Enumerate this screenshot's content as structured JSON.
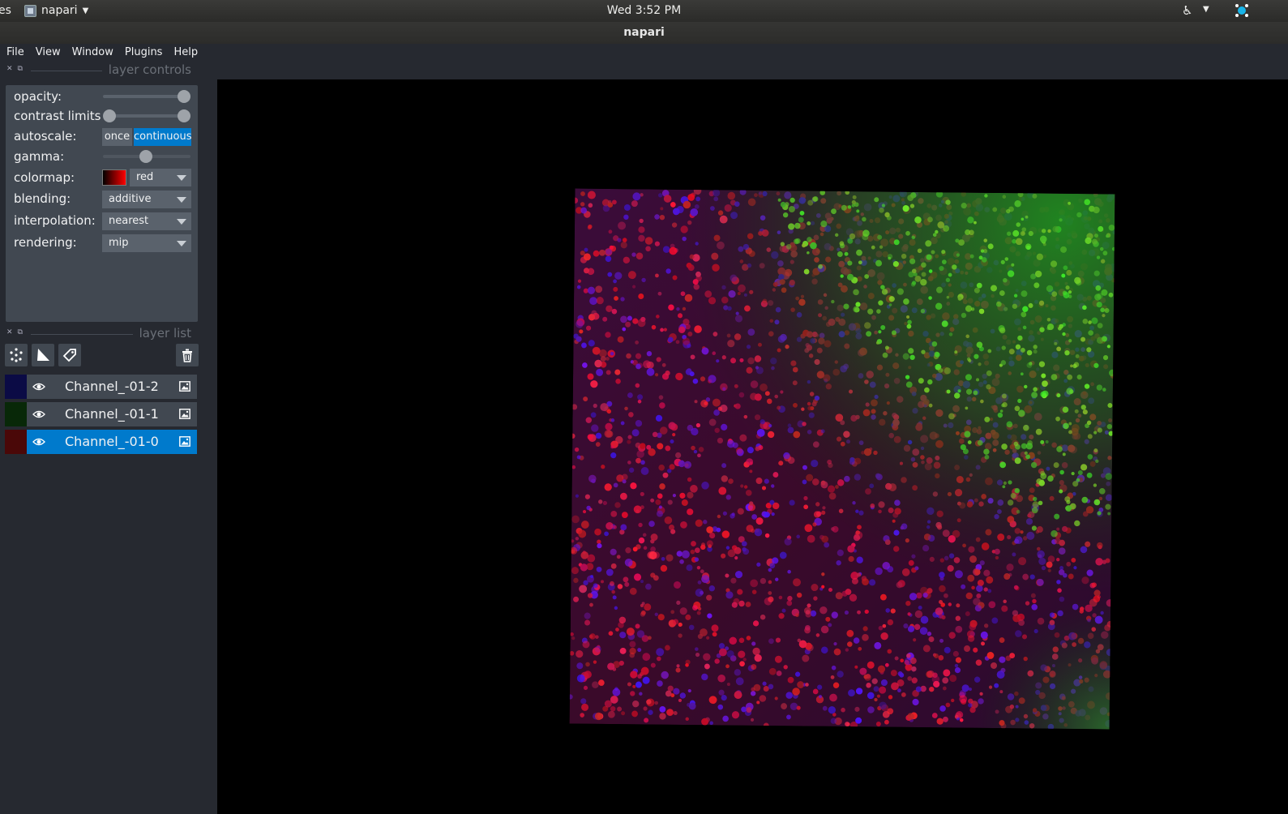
{
  "topbar": {
    "activities_fragment": "es",
    "app_name": "napari",
    "clock": "Wed  3:52 PM"
  },
  "window": {
    "title": "napari"
  },
  "menu": [
    "File",
    "View",
    "Window",
    "Plugins",
    "Help"
  ],
  "layer_controls": {
    "title": "layer controls",
    "opacity_label": "opacity:",
    "opacity_value": 1.0,
    "contrast_label": "contrast limits",
    "contrast_range": [
      0.0,
      1.0
    ],
    "autoscale_label": "autoscale:",
    "autoscale_once": "once",
    "autoscale_continuous": "continuous",
    "gamma_label": "gamma:",
    "gamma_value": 0.5,
    "colormap_label": "colormap:",
    "colormap_value": "red",
    "blending_label": "blending:",
    "blending_value": "additive",
    "interpolation_label": "interpolation:",
    "interpolation_value": "nearest",
    "rendering_label": "rendering:",
    "rendering_value": "mip"
  },
  "layer_list": {
    "title": "layer list",
    "layers": [
      {
        "name": "Channel_-01-2",
        "color": "#0b0b4a",
        "selected": false
      },
      {
        "name": "Channel_-01-1",
        "color": "#0a2a0a",
        "selected": false
      },
      {
        "name": "Channel_-01-0",
        "color": "#4a0a0a",
        "selected": true
      }
    ]
  },
  "colors": {
    "accent": "#007acc",
    "panel": "#262930",
    "control": "#414851"
  }
}
